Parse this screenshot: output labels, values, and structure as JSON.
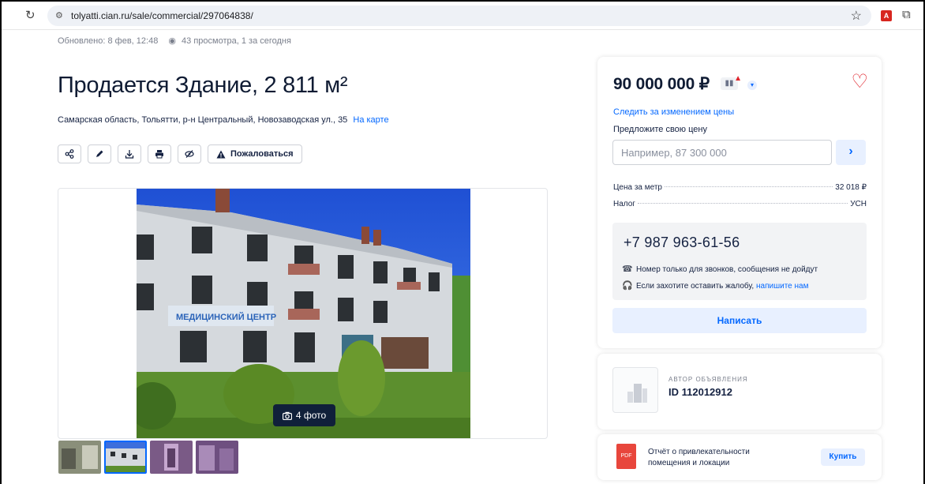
{
  "browser": {
    "url": "tolyatti.cian.ru/sale/commercial/297064838/"
  },
  "listing": {
    "updated": "Обновлено: 8 фев, 12:48",
    "views": "43 просмотра, 1 за сегодня",
    "title": "Продается Здание, 2 811 м²",
    "address": "Самарская область, Тольятти, р-н Центральный, Новозаводская ул., 35",
    "map_link": "На карте",
    "report_label": "Пожаловаться",
    "photo_count": "4 фото",
    "thumbnail_count": 4,
    "active_thumbnail": 2
  },
  "price_card": {
    "price": "90 000 000 ₽",
    "follow_price": "Следить за изменением цены",
    "offer_label": "Предложите свою цену",
    "offer_placeholder": "Например, 87 300 000",
    "price_per_meter_label": "Цена за метр",
    "price_per_meter_value": "32 018 ₽",
    "tax_label": "Налог",
    "tax_value": "УСН",
    "phone": "+7 987 963-61-56",
    "phone_note": "Номер только для звонков, сообщения не дойдут",
    "complaint_prefix": "Если захотите оставить жалобу,",
    "complaint_link": "напишите нам",
    "write_button": "Написать"
  },
  "author_card": {
    "label": "АВТОР ОБЪЯВЛЕНИЯ",
    "id": "ID 112012912"
  },
  "report_card": {
    "pdf_label": "PDF",
    "text": "Отчёт о привлекательности помещения и локации",
    "buy_button": "Купить"
  },
  "colors": {
    "accent": "#0468ff",
    "heart": "#e0242c",
    "text": "#152242"
  }
}
